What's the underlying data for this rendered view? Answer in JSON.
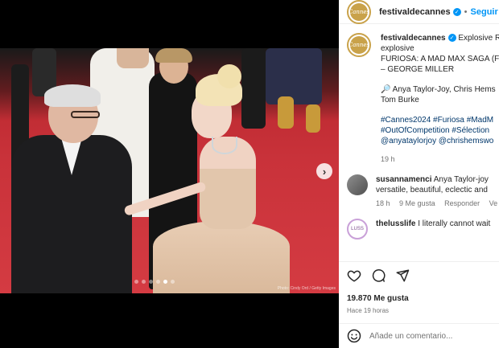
{
  "post": {
    "username": "festivaldecannes",
    "follow_label": "Seguir",
    "avatar_text": "Cannes",
    "media": {
      "credit": "Photo: Cindy Ord / Getty Images",
      "slide_count": 6,
      "active_slide": 5,
      "next_icon": "chevron-right-icon"
    }
  },
  "caption": {
    "username": "festivaldecannes",
    "lines": [
      "Explosive R",
      "explosive",
      "FURIOSA: A MAD MAX SAGA (F",
      "– GEORGE MILLER"
    ],
    "cast_line_1": "🔎 Anya Taylor-Joy, Chris Hems",
    "cast_line_2": "Tom Burke",
    "tags": [
      "#Cannes2024 #Furiosa #MadM",
      "#OutOfCompetition #Sélection",
      "@anyataylorjoy @chrishemswo"
    ],
    "time": "19 h"
  },
  "comments": [
    {
      "username": "susannamenci",
      "text_1": "Anya Taylor-joy",
      "text_2": "versatile, beautiful, eclectic and",
      "time": "18 h",
      "likes": "9 Me gusta",
      "reply": "Responder",
      "extra": "Ve",
      "avatar_color": "#7a7a7a"
    },
    {
      "username": "thelusslife",
      "text_1": "I literally cannot wait",
      "text_2": "",
      "time": "",
      "likes": "",
      "reply": "",
      "extra": "",
      "avatar_color": "#c9a0d8",
      "avatar_text": "LUSS"
    }
  ],
  "actions": {
    "like_icon": "heart-icon",
    "comment_icon": "comment-icon",
    "share_icon": "share-icon",
    "likes": "19.870 Me gusta",
    "posted": "Hace 19 horas"
  },
  "add_comment": {
    "placeholder": "Añade un comentario...",
    "emoji_icon": "emoji-icon"
  }
}
